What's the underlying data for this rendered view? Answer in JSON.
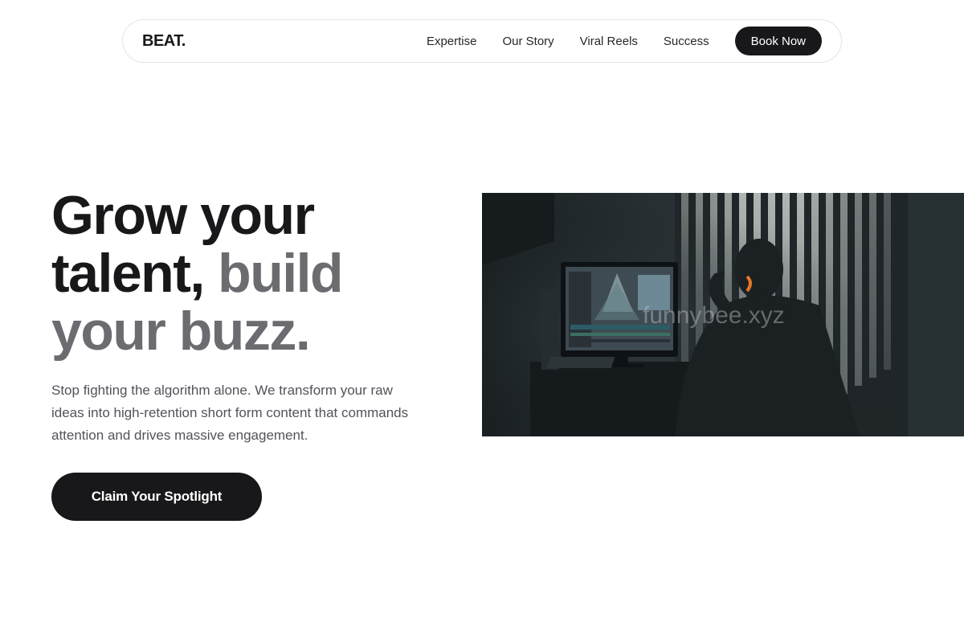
{
  "nav": {
    "logo": "BEAT.",
    "links": [
      "Expertise",
      "Our Story",
      "Viral Reels",
      "Success"
    ],
    "cta_label": "Book Now"
  },
  "hero": {
    "title_line1": "Grow your",
    "title_line2_dark": "talent,",
    "title_line2_gray": "build",
    "title_line3_gray": "your buzz.",
    "subtitle": "Stop fighting the algorithm alone. We transform your raw ideas into high-retention short form content that commands attention and drives massive engagement.",
    "cta_label": "Claim Your Spotlight",
    "image": {
      "description": "video-editor-at-monitor-photo",
      "watermark": "funnybee.xyz"
    }
  },
  "colors": {
    "dark": "#18181b",
    "gray_accent": "#6b6b70",
    "headphone_accent": "#e8742a"
  }
}
